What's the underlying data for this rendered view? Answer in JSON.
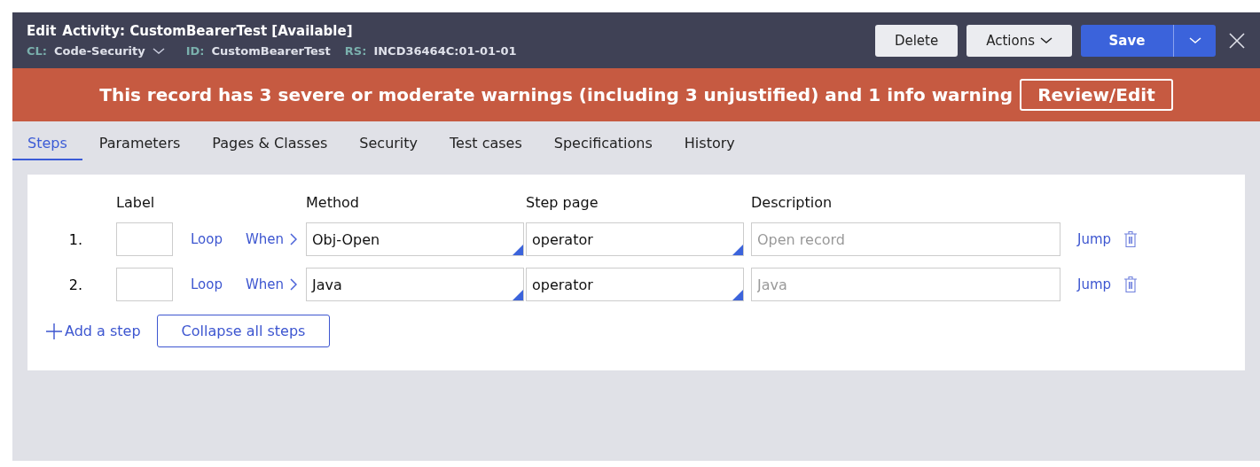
{
  "header": {
    "action": "Edit",
    "title": "Activity: CustomBearerTest [Available]",
    "meta": [
      {
        "key": "CL:",
        "value": "Code-Security",
        "dropdown": true
      },
      {
        "key": "ID:",
        "value": "CustomBearerTest",
        "dropdown": false
      },
      {
        "key": "RS:",
        "value": "INCD36464C:01-01-01",
        "dropdown": false
      }
    ],
    "buttons": [
      {
        "label": "Delete",
        "kind": "plain"
      },
      {
        "label": "Actions",
        "kind": "menu"
      },
      {
        "label": "Save",
        "kind": "primary"
      }
    ]
  },
  "banner": {
    "message": "This record has 3 severe or moderate warnings (including 3 unjustified) and 1 info warning",
    "button": "Review/Edit"
  },
  "tabs": [
    {
      "label": "Steps",
      "selected": true
    },
    {
      "label": "Parameters",
      "selected": false
    },
    {
      "label": "Pages & Classes",
      "selected": false
    },
    {
      "label": "Security",
      "selected": false
    },
    {
      "label": "Test cases",
      "selected": false
    },
    {
      "label": "Specifications",
      "selected": false
    },
    {
      "label": "History",
      "selected": false
    }
  ],
  "steps": {
    "columns": [
      "Label",
      "Method",
      "Step page",
      "Description"
    ],
    "rows": [
      {
        "number": "1.",
        "loop": "Loop",
        "when": "When",
        "method": "Obj-Open",
        "step_page": "operator",
        "description_placeholder": "Open record",
        "jump": "Jump"
      },
      {
        "number": "2.",
        "loop": "Loop",
        "when": "When",
        "method": "Java",
        "step_page": "operator",
        "description_placeholder": "Java",
        "jump": "Jump"
      }
    ],
    "add_step": "Add a step",
    "collapse_button": "Collapse all steps"
  }
}
